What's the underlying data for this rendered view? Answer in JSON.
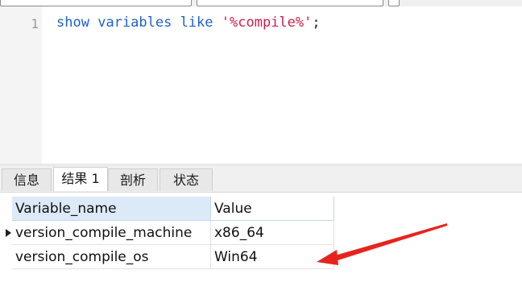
{
  "editor": {
    "line_number": "1",
    "code": {
      "kw1": "show",
      "kw2": "variables",
      "kw3": "like",
      "string": "'%compile%'",
      "semicolon": ";"
    }
  },
  "result_tabs": [
    "信息",
    "结果 1",
    "剖析",
    "状态"
  ],
  "active_tab_index": 1,
  "table": {
    "columns": [
      "Variable_name",
      "Value"
    ],
    "rows": [
      {
        "Variable_name": "version_compile_machine",
        "Value": "x86_64"
      },
      {
        "Variable_name": "version_compile_os",
        "Value": "Win64"
      }
    ],
    "current_row_index": 0
  },
  "colors": {
    "keyword": "#1f62c8",
    "string": "#c9224e",
    "header_bg": "#dce9f7",
    "annotation_arrow": "#e8231e"
  },
  "icons": {
    "row_indicator": "triangle-right-icon",
    "annotation": "red-arrow-icon"
  }
}
